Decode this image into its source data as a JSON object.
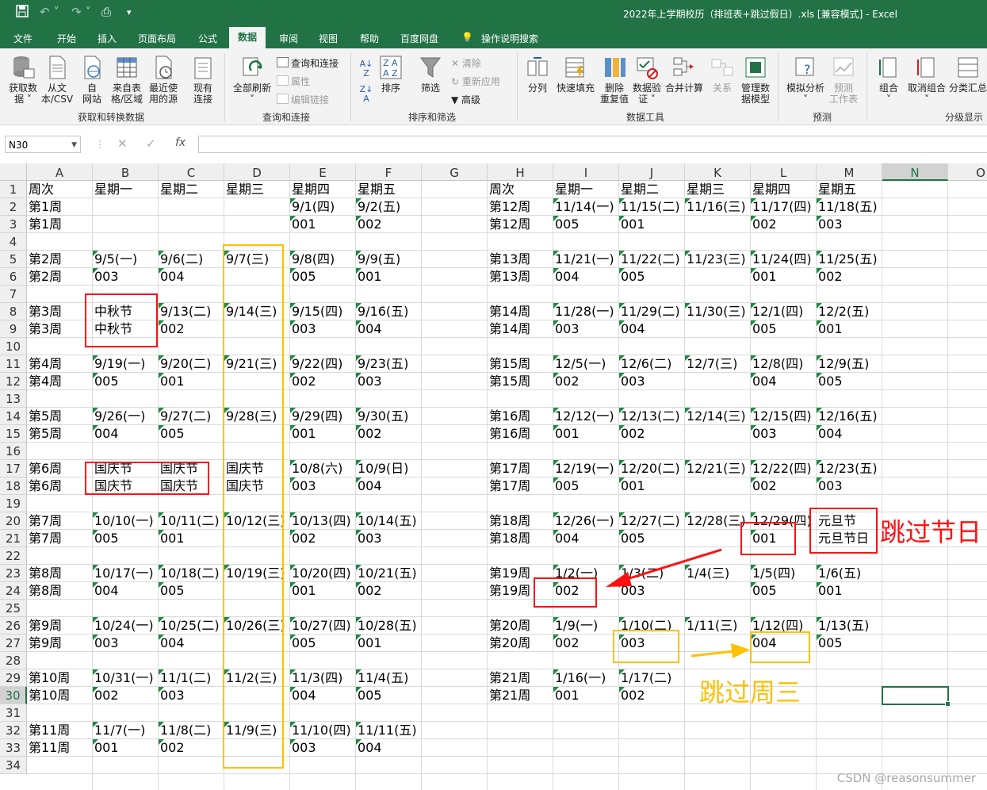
{
  "window": {
    "title": "2022年上学期校历（排班表+跳过假日）.xls  [兼容模式]  -  Excel"
  },
  "ribbon_tabs": [
    "文件",
    "开始",
    "插入",
    "页面布局",
    "公式",
    "数据",
    "审阅",
    "视图",
    "帮助",
    "百度网盘",
    "操作说明搜索"
  ],
  "active_tab": "数据",
  "ribbon": {
    "get_data": "获取数\n据 ˅",
    "from_text": "从文\n本/CSV",
    "from_web": "自\n网站",
    "from_table": "来自表\n格/区域",
    "recent_sources": "最近使\n用的源",
    "existing_conn": "现有\n连接",
    "group_get": "获取和转换数据",
    "refresh_all": "全部刷新\n˅",
    "queries_conn": "查询和连接",
    "properties": "属性",
    "edit_links": "编辑链接",
    "group_query": "查询和连接",
    "sort": "排序",
    "filter": "筛选",
    "clear": "清除",
    "reapply": "重新应用",
    "advanced": "高级",
    "group_sort": "排序和筛选",
    "text_to_cols": "分列",
    "flash_fill": "快速填充",
    "remove_dup": "删除\n重复值",
    "validation": "数据验\n证 ˅",
    "consolidate": "合并计算",
    "relations": "关系",
    "data_model": "管理数\n据模型",
    "group_tools": "数据工具",
    "whatif": "模拟分析\n˅",
    "forecast_sheet": "预测\n工作表",
    "group_forecast": "预测",
    "group_btn": "组合\n˅",
    "ungroup_btn": "取消组合\n˅",
    "subtotal": "分类汇总",
    "group_outline": "分级显示"
  },
  "name_box": "N30",
  "columns": [
    "A",
    "B",
    "C",
    "D",
    "E",
    "F",
    "G",
    "H",
    "I",
    "J",
    "K",
    "L",
    "M",
    "N",
    "O"
  ],
  "rows": [
    [
      "周次",
      "星期一",
      "星期二",
      "星期三",
      "星期四",
      "星期五",
      "",
      "周次",
      "星期一",
      "星期二",
      "星期三",
      "星期四",
      "星期五"
    ],
    [
      "第1周",
      "",
      "",
      "",
      "9/1(四)",
      "9/2(五)",
      "",
      "第12周",
      "11/14(一)",
      "11/15(二)",
      "11/16(三)",
      "11/17(四)",
      "11/18(五)"
    ],
    [
      "第1周",
      "",
      "",
      "",
      "001",
      "002",
      "",
      "第12周",
      "005",
      "001",
      "",
      "002",
      "003"
    ],
    [],
    [
      "第2周",
      "9/5(一)",
      "9/6(二)",
      "9/7(三)",
      "9/8(四)",
      "9/9(五)",
      "",
      "第13周",
      "11/21(一)",
      "11/22(二)",
      "11/23(三)",
      "11/24(四)",
      "11/25(五)"
    ],
    [
      "第2周",
      "003",
      "004",
      "",
      "005",
      "001",
      "",
      "第13周",
      "004",
      "005",
      "",
      "001",
      "002"
    ],
    [],
    [
      "第3周",
      "中秋节",
      "9/13(二)",
      "9/14(三)",
      "9/15(四)",
      "9/16(五)",
      "",
      "第14周",
      "11/28(一)",
      "11/29(二)",
      "11/30(三)",
      "12/1(四)",
      "12/2(五)"
    ],
    [
      "第3周",
      "中秋节",
      "002",
      "",
      "003",
      "004",
      "",
      "第14周",
      "003",
      "004",
      "",
      "005",
      "001"
    ],
    [],
    [
      "第4周",
      "9/19(一)",
      "9/20(二)",
      "9/21(三)",
      "9/22(四)",
      "9/23(五)",
      "",
      "第15周",
      "12/5(一)",
      "12/6(二)",
      "12/7(三)",
      "12/8(四)",
      "12/9(五)"
    ],
    [
      "第4周",
      "005",
      "001",
      "",
      "002",
      "003",
      "",
      "第15周",
      "002",
      "003",
      "",
      "004",
      "005"
    ],
    [],
    [
      "第5周",
      "9/26(一)",
      "9/27(二)",
      "9/28(三)",
      "9/29(四)",
      "9/30(五)",
      "",
      "第16周",
      "12/12(一)",
      "12/13(二)",
      "12/14(三)",
      "12/15(四)",
      "12/16(五)"
    ],
    [
      "第5周",
      "004",
      "005",
      "",
      "001",
      "002",
      "",
      "第16周",
      "001",
      "002",
      "",
      "003",
      "004"
    ],
    [],
    [
      "第6周",
      "国庆节",
      "国庆节",
      "国庆节",
      "10/8(六)",
      "10/9(日)",
      "",
      "第17周",
      "12/19(一)",
      "12/20(二)",
      "12/21(三)",
      "12/22(四)",
      "12/23(五)"
    ],
    [
      "第6周",
      "国庆节",
      "国庆节",
      "国庆节",
      "003",
      "004",
      "",
      "第17周",
      "005",
      "001",
      "",
      "002",
      "003"
    ],
    [],
    [
      "第7周",
      "10/10(一)",
      "10/11(二)",
      "10/12(三)",
      "10/13(四)",
      "10/14(五)",
      "",
      "第18周",
      "12/26(一)",
      "12/27(二)",
      "12/28(三)",
      "12/29(四)",
      "元旦节"
    ],
    [
      "第7周",
      "005",
      "001",
      "",
      "002",
      "003",
      "",
      "第18周",
      "004",
      "005",
      "",
      "001",
      "元旦节日"
    ],
    [],
    [
      "第8周",
      "10/17(一)",
      "10/18(二)",
      "10/19(三)",
      "10/20(四)",
      "10/21(五)",
      "",
      "第19周",
      "1/2(一)",
      "1/3(二)",
      "1/4(三)",
      "1/5(四)",
      "1/6(五)"
    ],
    [
      "第8周",
      "004",
      "005",
      "",
      "001",
      "002",
      "",
      "第19周",
      "002",
      "003",
      "",
      "005",
      "001"
    ],
    [],
    [
      "第9周",
      "10/24(一)",
      "10/25(二)",
      "10/26(三)",
      "10/27(四)",
      "10/28(五)",
      "",
      "第20周",
      "1/9(一)",
      "1/10(二)",
      "1/11(三)",
      "1/12(四)",
      "1/13(五)"
    ],
    [
      "第9周",
      "003",
      "004",
      "",
      "005",
      "001",
      "",
      "第20周",
      "002",
      "003",
      "",
      "004",
      "005"
    ],
    [],
    [
      "第10周",
      "10/31(一)",
      "11/1(二)",
      "11/2(三)",
      "11/3(四)",
      "11/4(五)",
      "",
      "第21周",
      "1/16(一)",
      "1/17(二)"
    ],
    [
      "第10周",
      "002",
      "003",
      "",
      "004",
      "005",
      "",
      "第21周",
      "001",
      "002"
    ],
    [],
    [
      "第11周",
      "11/7(一)",
      "11/8(二)",
      "11/9(三)",
      "11/10(四)",
      "11/11(五)"
    ],
    [
      "第11周",
      "001",
      "002",
      "",
      "003",
      "004"
    ],
    []
  ],
  "annotations": {
    "skip_holiday": "跳过节日",
    "skip_wednesday": "跳过周三"
  },
  "colors": {
    "excel_green": "#217346",
    "red_box": "#ff1010",
    "orange_box": "#ffc000",
    "text_triangle": "#1f8a43"
  },
  "watermark": "CSDN @reasonsummer"
}
